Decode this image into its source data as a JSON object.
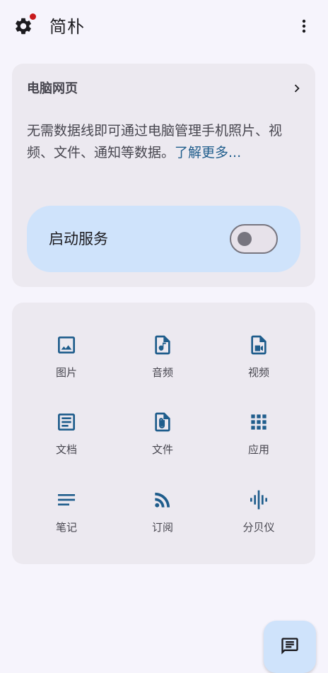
{
  "app": {
    "title": "简朴"
  },
  "web_card": {
    "title": "电脑网页",
    "description": "无需数据线即可通过电脑管理手机照片、视频、文件、通知等数据。",
    "learn_more": "了解更多...",
    "service_label": "启动服务",
    "service_enabled": false
  },
  "grid": {
    "items": [
      {
        "label": "图片",
        "icon": "image-icon"
      },
      {
        "label": "音频",
        "icon": "audio-file-icon"
      },
      {
        "label": "视频",
        "icon": "video-file-icon"
      },
      {
        "label": "文档",
        "icon": "document-icon"
      },
      {
        "label": "文件",
        "icon": "attachment-file-icon"
      },
      {
        "label": "应用",
        "icon": "apps-icon"
      },
      {
        "label": "笔记",
        "icon": "notes-icon"
      },
      {
        "label": "订阅",
        "icon": "rss-icon"
      },
      {
        "label": "分贝仪",
        "icon": "sound-wave-icon"
      }
    ]
  },
  "colors": {
    "background": "#f6f4fc",
    "card": "#ece9f0",
    "accent_container": "#cfe3fb",
    "icon_accent": "#1f5d8c",
    "notification_dot": "#c8191c"
  }
}
